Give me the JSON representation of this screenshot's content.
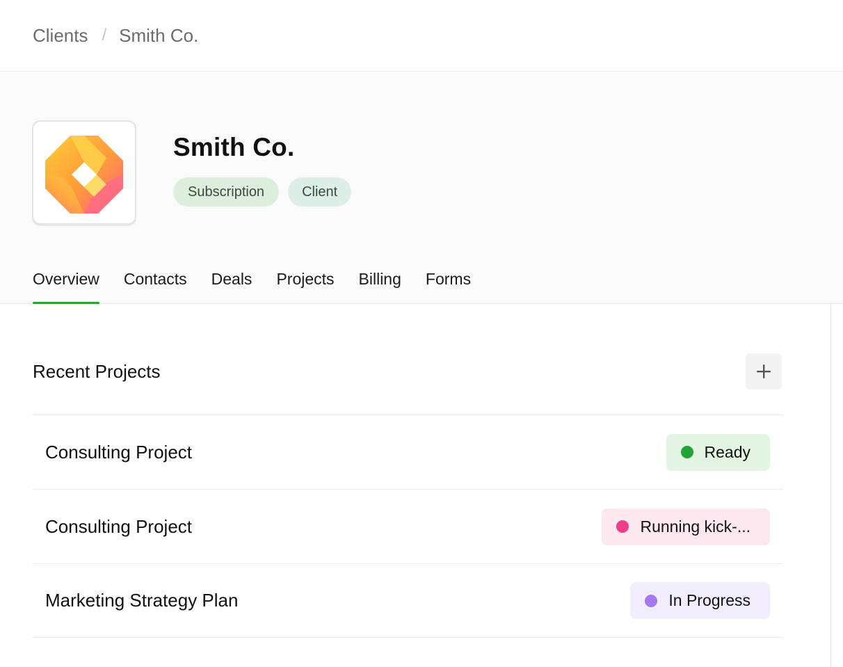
{
  "breadcrumb": {
    "parent": "Clients",
    "separator": "/",
    "current": "Smith Co."
  },
  "client": {
    "name": "Smith Co.",
    "logo_icon": "diamond-chain-logo",
    "tags": [
      "Subscription",
      "Client"
    ]
  },
  "tabs": [
    {
      "label": "Overview",
      "active": true
    },
    {
      "label": "Contacts",
      "active": false
    },
    {
      "label": "Deals",
      "active": false
    },
    {
      "label": "Projects",
      "active": false
    },
    {
      "label": "Billing",
      "active": false
    },
    {
      "label": "Forms",
      "active": false
    }
  ],
  "recent_projects": {
    "title": "Recent Projects",
    "add_icon": "plus-icon",
    "items": [
      {
        "name": "Consulting Project",
        "status": "Ready",
        "status_color": "#22a33a",
        "status_bg": "#e4f4e3"
      },
      {
        "name": "Consulting Project",
        "status": "Running kick-...",
        "status_color": "#ee3f8a",
        "status_bg": "#fde8ef"
      },
      {
        "name": "Marketing Strategy Plan",
        "status": "In Progress",
        "status_color": "#a678f0",
        "status_bg": "#f1edfd"
      }
    ]
  },
  "colors": {
    "accent": "#27a33a",
    "header_bg": "#fafafa"
  }
}
